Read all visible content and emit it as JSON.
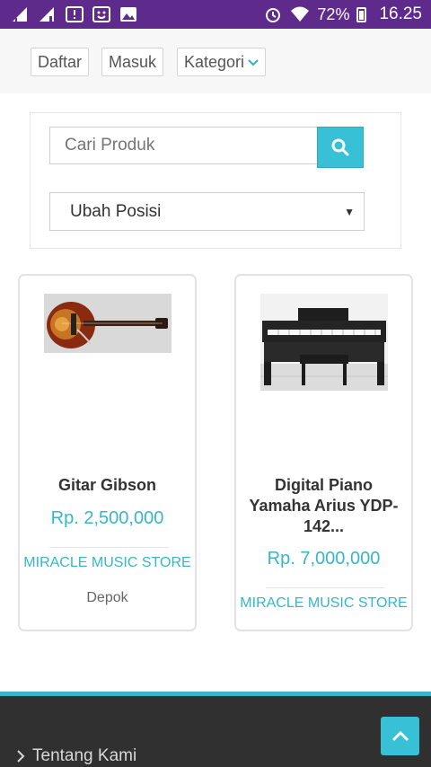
{
  "status_bar": {
    "battery": "72%",
    "time": "16.25"
  },
  "nav": {
    "daftar": "Daftar",
    "masuk": "Masuk",
    "kategori": "Kategori"
  },
  "search": {
    "placeholder": "Cari Produk",
    "sort_selected": "Ubah Posisi"
  },
  "products": [
    {
      "name": "Gitar Gibson",
      "price": "Rp. 2,500,000",
      "store": "MIRACLE MUSIC STORE",
      "city": "Depok"
    },
    {
      "name": "Digital Piano Yamaha Arius YDP-142...",
      "price": "Rp. 7,000,000",
      "store": "MIRACLE MUSIC STORE"
    }
  ],
  "footer": {
    "link": "Tentang Kami"
  },
  "colors": {
    "status_bar": "#5e2a8c",
    "accent": "#37b6c9",
    "footer": "#303030"
  },
  "icons": [
    "signal-icon",
    "signal-icon",
    "notification-icon",
    "notification-icon",
    "image-icon",
    "alarm-icon",
    "wifi-icon",
    "battery-icon",
    "search-icon",
    "chevron-down-icon",
    "caret-down-icon",
    "chevron-right-icon",
    "chevron-up-icon"
  ]
}
